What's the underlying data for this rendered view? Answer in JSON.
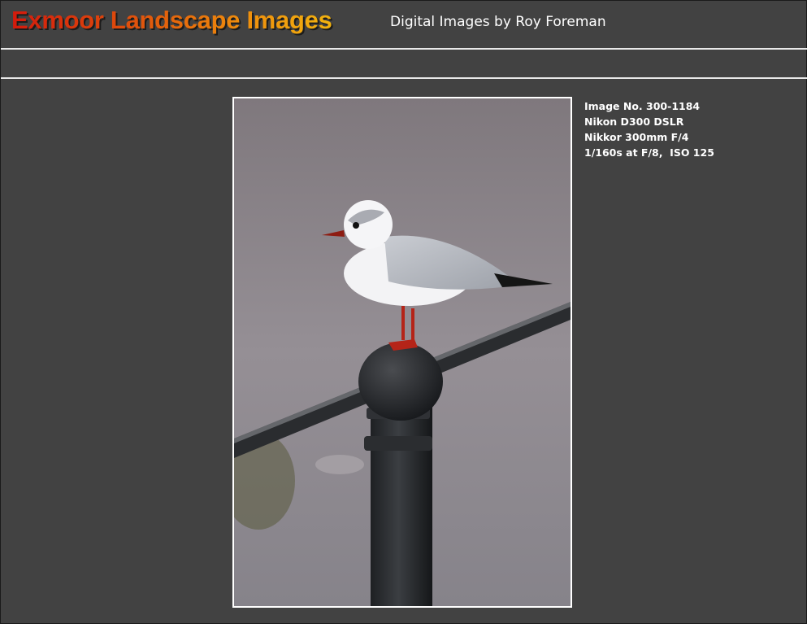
{
  "header": {
    "site_title": "Exmoor Landscape Images",
    "tagline": "Digital Images by Roy Foreman"
  },
  "image_details": {
    "image_number": "Image No. 300-1184",
    "camera": "Nikon D300 DSLR",
    "lens": "Nikkor 300mm F/4",
    "exposure": "1/160s at F/8,  ISO 125"
  },
  "colors": {
    "background": "#424242",
    "title_gradient_start": "#d41a0c",
    "title_gradient_end": "#f2b30f",
    "text": "#ffffff"
  }
}
